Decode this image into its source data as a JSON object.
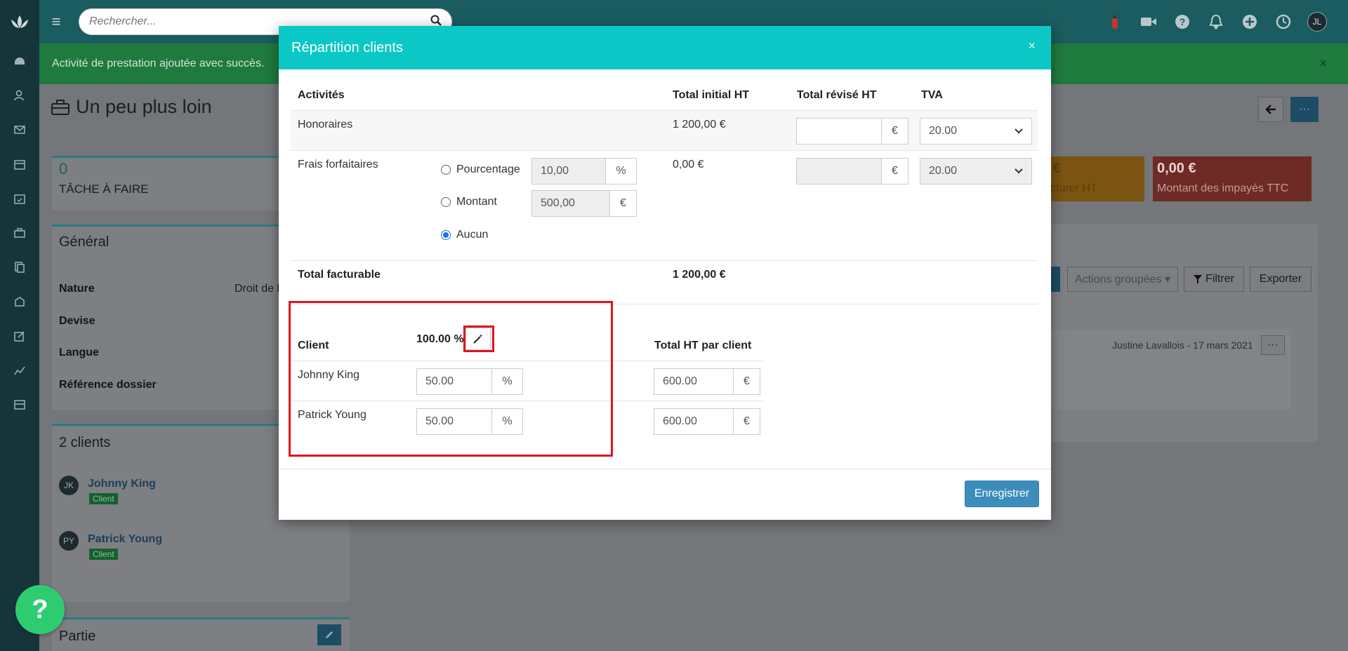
{
  "topbar": {
    "search_placeholder": "Rechercher...",
    "avatar_initials": "JL"
  },
  "notification": {
    "message": "Activité de prestation ajoutée avec succès.",
    "close": "×"
  },
  "page": {
    "title": "Un peu plus loin",
    "tasks": {
      "count": "0",
      "label": "TÂCHE À FAIRE"
    },
    "general": {
      "heading": "Général",
      "fields": [
        {
          "label": "Nature",
          "value": "Droit de l"
        },
        {
          "label": "Devise",
          "value": ""
        },
        {
          "label": "Langue",
          "value": ""
        },
        {
          "label": "Référence dossier",
          "value": ""
        }
      ]
    },
    "clients_panel": {
      "heading": "2 clients",
      "clients": [
        {
          "initials": "JK",
          "name": "Johnny King",
          "badge": "Client"
        },
        {
          "initials": "PY",
          "name": "Patrick Young",
          "badge": "Client"
        }
      ]
    },
    "partie_heading": "Partie",
    "kpis": [
      {
        "value": "€",
        "label": "cturer HT",
        "color": "#7a5410"
      },
      {
        "value": "0,00 €",
        "label": "Montant des impayés TTC",
        "color": "#6e2a25"
      }
    ],
    "actions": {
      "grouped": "Actions groupées ▾",
      "filter": "Filtrer",
      "export": "Exporter"
    },
    "timeline_meta": "Justine Lavallois - 17 mars 2021"
  },
  "modal": {
    "title": "Répartition clients",
    "close": "×",
    "table_headers": {
      "activities": "Activités",
      "total_initial": "Total initial HT",
      "total_revised": "Total révisé HT",
      "tva": "TVA"
    },
    "rows": [
      {
        "activity": "Honoraires",
        "initial": "1 200,00 €",
        "revised": "",
        "currency": "€",
        "tva": "20.00"
      },
      {
        "activity": "Frais forfaitaires",
        "initial": "0,00 €",
        "revised": "",
        "currency": "€",
        "tva": "20.00"
      }
    ],
    "frais_options": [
      {
        "label": "Pourcentage",
        "value": "10,00",
        "unit": "%",
        "checked": false
      },
      {
        "label": "Montant",
        "value": "500,00",
        "unit": "€",
        "checked": false
      },
      {
        "label": "Aucun",
        "checked": true
      }
    ],
    "total_facturable": {
      "label": "Total facturable",
      "value": "1 200,00 €"
    },
    "clients": {
      "header_client": "Client",
      "total_percent": "100.00 %",
      "header_total": "Total HT par client",
      "rows": [
        {
          "name": "Johnny King",
          "percent": "50.00",
          "percent_unit": "%",
          "amount": "600.00",
          "amount_unit": "€"
        },
        {
          "name": "Patrick Young",
          "percent": "50.00",
          "percent_unit": "%",
          "amount": "600.00",
          "amount_unit": "€"
        }
      ]
    },
    "save_label": "Enregistrer"
  },
  "help_fab": "?"
}
